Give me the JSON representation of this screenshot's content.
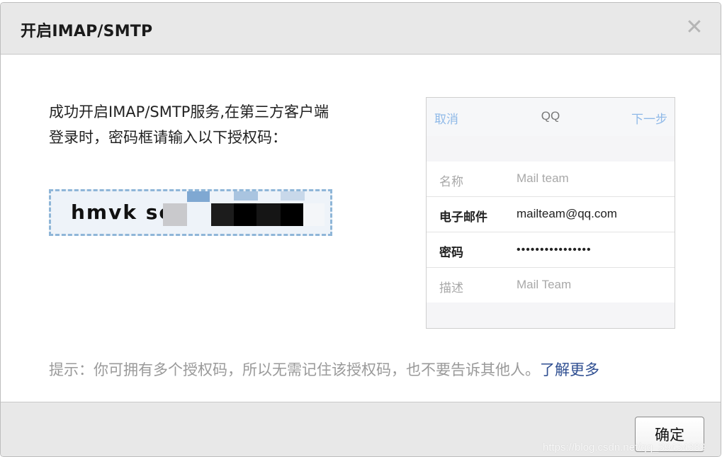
{
  "dialog": {
    "title": "开启IMAP/SMTP",
    "close_glyph": "✕",
    "message_line1": "成功开启IMAP/SMTP服务,在第三方客户端",
    "message_line2": "登录时，密码框请输入以下授权码：",
    "auth_code_visible": "hmvk sc",
    "tip_text": "提示：你可拥有多个授权码，所以无需记住该授权码，也不要告诉其他人。",
    "learn_more": "了解更多",
    "ok_label": "确定",
    "watermark": "https://blog.csdn.net/qq_39434389"
  },
  "phone_preview": {
    "cancel": "取消",
    "title": "QQ",
    "next": "下一步",
    "rows": [
      {
        "label": "名称",
        "value": "Mail team"
      },
      {
        "label": "电子邮件",
        "value": "mailteam@qq.com"
      },
      {
        "label": "密码",
        "value": "••••••••••••••••"
      },
      {
        "label": "描述",
        "value": "Mail Team"
      }
    ]
  },
  "colors": {
    "accent_link": "#2e4e91",
    "phone_nav_link": "#8fb9e8",
    "code_border": "#8fb6d8"
  }
}
